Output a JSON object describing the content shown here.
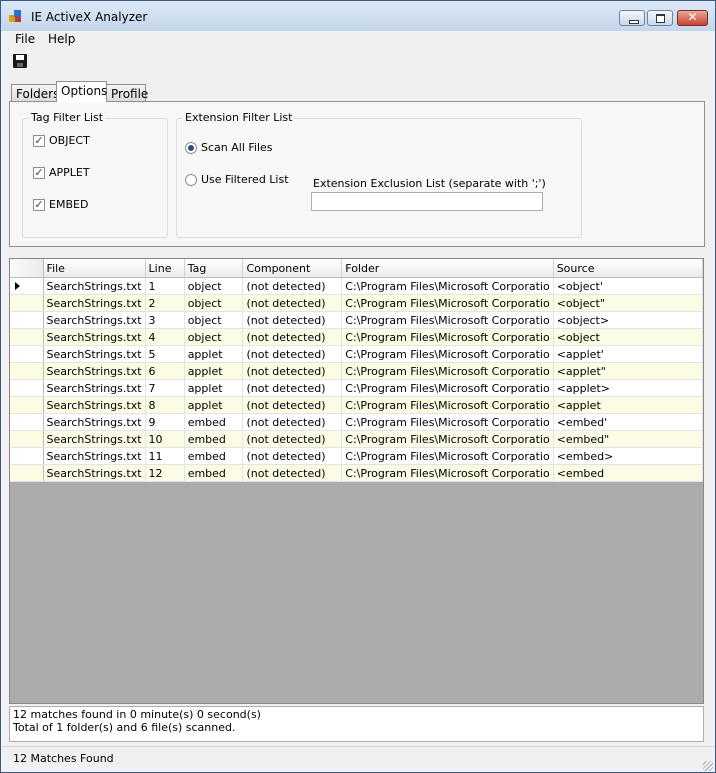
{
  "window": {
    "title": "IE ActiveX Analyzer"
  },
  "menu": {
    "items": [
      "File",
      "Help"
    ]
  },
  "toolbar": {
    "save_icon": "save-icon"
  },
  "tabs": [
    {
      "label": "Folders",
      "active": false
    },
    {
      "label": "Options",
      "active": true
    },
    {
      "label": "Profile",
      "active": false
    }
  ],
  "tag_filter": {
    "title": "Tag Filter List",
    "items": [
      {
        "label": "OBJECT",
        "checked": true
      },
      {
        "label": "APPLET",
        "checked": true
      },
      {
        "label": "EMBED",
        "checked": true
      }
    ]
  },
  "extension_filter": {
    "title": "Extension Filter List",
    "options": [
      {
        "label": "Scan All Files",
        "selected": true
      },
      {
        "label": "Use Filtered List",
        "selected": false
      }
    ],
    "exclusion_label": "Extension Exclusion List (separate with ';')",
    "exclusion_value": ""
  },
  "results": {
    "columns": [
      "File",
      "Line",
      "Tag",
      "Component",
      "Folder",
      "Source"
    ],
    "rows": [
      [
        "SearchStrings.txt",
        "1",
        "object",
        "(not detected)",
        "C:\\Program Files\\Microsoft Corporatio",
        "<object'"
      ],
      [
        "SearchStrings.txt",
        "2",
        "object",
        "(not detected)",
        "C:\\Program Files\\Microsoft Corporatio",
        "<object\""
      ],
      [
        "SearchStrings.txt",
        "3",
        "object",
        "(not detected)",
        "C:\\Program Files\\Microsoft Corporatio",
        "<object>"
      ],
      [
        "SearchStrings.txt",
        "4",
        "object",
        "(not detected)",
        "C:\\Program Files\\Microsoft Corporatio",
        "<object"
      ],
      [
        "SearchStrings.txt",
        "5",
        "applet",
        "(not detected)",
        "C:\\Program Files\\Microsoft Corporatio",
        "<applet'"
      ],
      [
        "SearchStrings.txt",
        "6",
        "applet",
        "(not detected)",
        "C:\\Program Files\\Microsoft Corporatio",
        "<applet\""
      ],
      [
        "SearchStrings.txt",
        "7",
        "applet",
        "(not detected)",
        "C:\\Program Files\\Microsoft Corporatio",
        "<applet>"
      ],
      [
        "SearchStrings.txt",
        "8",
        "applet",
        "(not detected)",
        "C:\\Program Files\\Microsoft Corporatio",
        "<applet"
      ],
      [
        "SearchStrings.txt",
        "9",
        "embed",
        "(not detected)",
        "C:\\Program Files\\Microsoft Corporatio",
        "<embed'"
      ],
      [
        "SearchStrings.txt",
        "10",
        "embed",
        "(not detected)",
        "C:\\Program Files\\Microsoft Corporatio",
        "<embed\""
      ],
      [
        "SearchStrings.txt",
        "11",
        "embed",
        "(not detected)",
        "C:\\Program Files\\Microsoft Corporatio",
        "<embed>"
      ],
      [
        "SearchStrings.txt",
        "12",
        "embed",
        "(not detected)",
        "C:\\Program Files\\Microsoft Corporatio",
        "<embed"
      ]
    ]
  },
  "summary": {
    "line1": "12 matches found in 0 minute(s) 0 second(s)",
    "line2": "Total of 1 folder(s) and 6 file(s) scanned."
  },
  "statusbar": {
    "text": "12 Matches Found"
  },
  "colors": {
    "alt_row": "#fcfce4",
    "grid_background": "#ababab",
    "title_gradient_top": "#dde9f6"
  }
}
